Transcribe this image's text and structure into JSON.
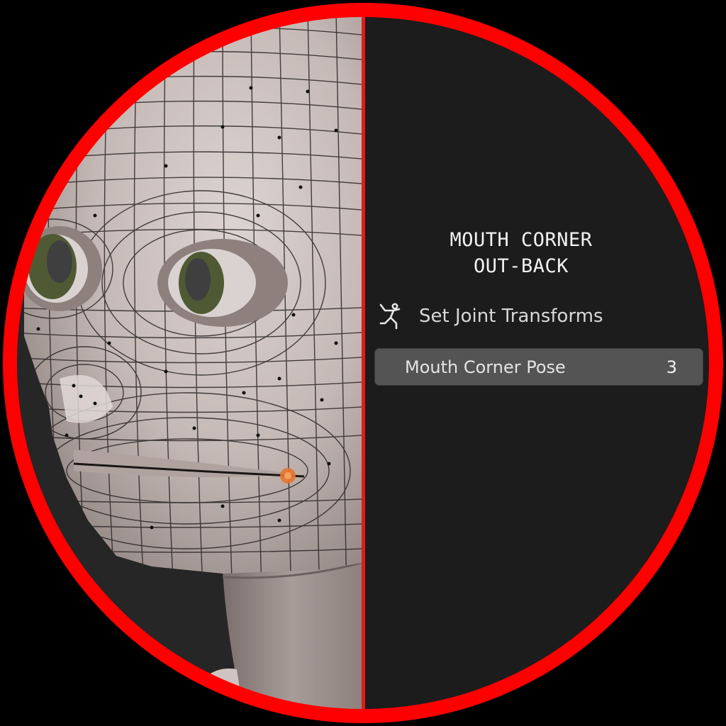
{
  "panel": {
    "caption_line1": "MOUTH CORNER",
    "caption_line2": "OUT-BACK",
    "operator_label": "Set Joint Transforms",
    "operator_icon": "armature-pose-icon",
    "property_name": "Mouth Corner Pose",
    "property_value": "3"
  },
  "colors": {
    "frame_ring": "#ff0000",
    "divider": "#e21b1b",
    "panel_bg": "#1c1c1c",
    "field_bg": "#545454",
    "selected_vertex": "#e8742a",
    "iris": "#4f5a34"
  }
}
